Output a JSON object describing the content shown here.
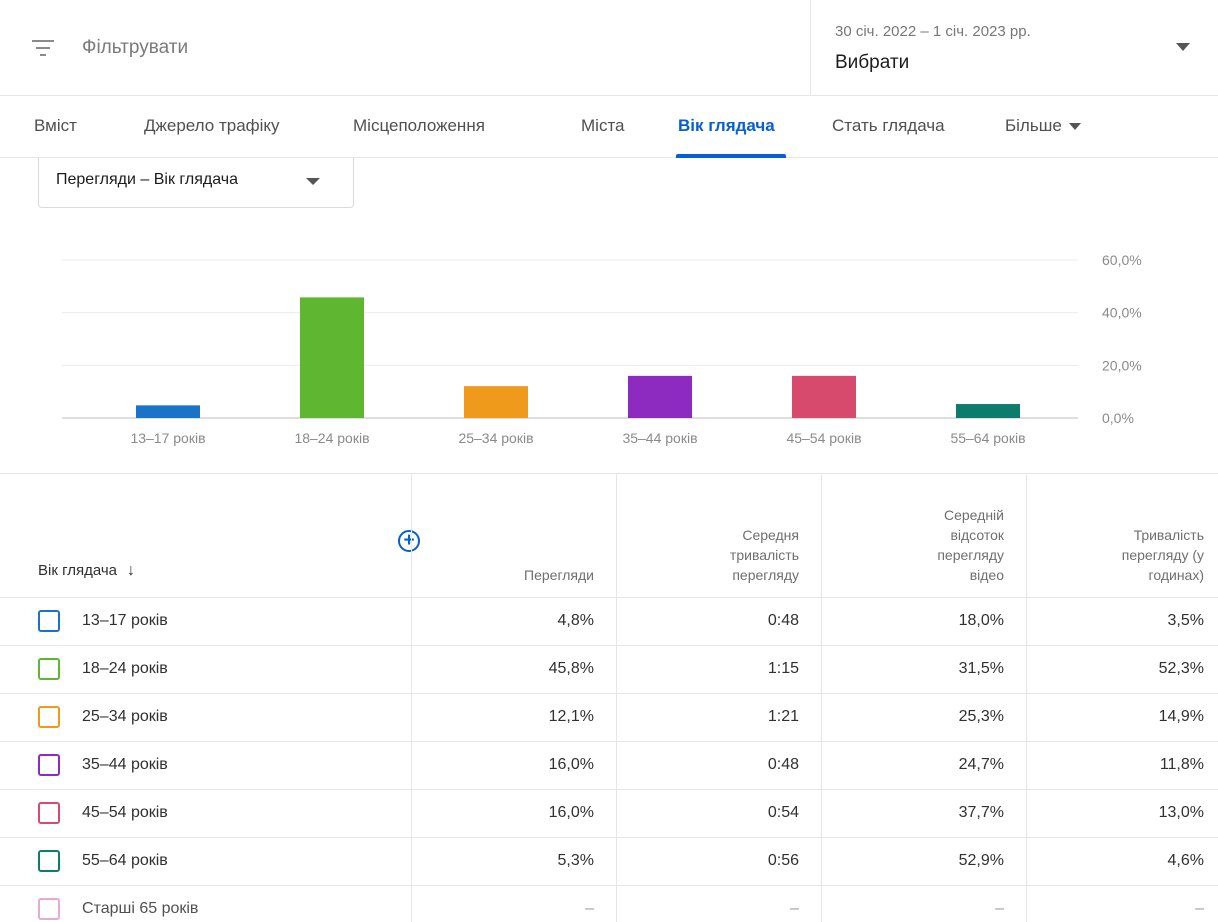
{
  "filter": {
    "label": "Фільтрувати"
  },
  "date": {
    "range": "30 січ. 2022 – 1 січ. 2023 рр.",
    "selector": "Вибрати"
  },
  "tabs": [
    {
      "label": "Вміст",
      "active": false
    },
    {
      "label": "Джерело трафіку",
      "active": false
    },
    {
      "label": "Місцеположення",
      "active": false
    },
    {
      "label": "Міста",
      "active": false
    },
    {
      "label": "Вік глядача",
      "active": true
    },
    {
      "label": "Стать глядача",
      "active": false
    },
    {
      "label": "Більше",
      "active": false
    }
  ],
  "metric_dropdown": {
    "label": "Перегляди – Вік глядача"
  },
  "chart_data": {
    "type": "bar",
    "categories": [
      "13–17 років",
      "18–24 років",
      "25–34 років",
      "35–44 років",
      "45–54 років",
      "55–64 років"
    ],
    "values": [
      4.8,
      45.8,
      12.1,
      16.0,
      16.0,
      5.3
    ],
    "colors": [
      "#1a73c8",
      "#5fb631",
      "#ef9a1a",
      "#8d2bc0",
      "#d84a6d",
      "#0c7c6c"
    ],
    "y_ticks": [
      "0,0%",
      "20,0%",
      "40,0%",
      "60,0%"
    ],
    "y_tick_values": [
      0,
      20,
      40,
      60
    ],
    "ylim": [
      0,
      60
    ],
    "grid": true,
    "y_axis_side": "right"
  },
  "table": {
    "columns": {
      "dimension": "Вік глядача",
      "views": "Перегляди",
      "avg_duration": [
        "Середня",
        "тривалість",
        "перегляду"
      ],
      "avg_percent": [
        "Середній",
        "відсоток",
        "перегляду",
        "відео"
      ],
      "watch_time": [
        "Тривалість",
        "перегляду (у",
        "годинах)"
      ]
    },
    "rows": [
      {
        "label": "13–17 років",
        "views": "4,8%",
        "avg_duration": "0:48",
        "avg_percent": "18,0%",
        "watch_time": "3,5%",
        "color": "#1a73c8"
      },
      {
        "label": "18–24 років",
        "views": "45,8%",
        "avg_duration": "1:15",
        "avg_percent": "31,5%",
        "watch_time": "52,3%",
        "color": "#5fb631"
      },
      {
        "label": "25–34 років",
        "views": "12,1%",
        "avg_duration": "1:21",
        "avg_percent": "25,3%",
        "watch_time": "14,9%",
        "color": "#ef9a1a"
      },
      {
        "label": "35–44 років",
        "views": "16,0%",
        "avg_duration": "0:48",
        "avg_percent": "24,7%",
        "watch_time": "11,8%",
        "color": "#8d2bc0"
      },
      {
        "label": "45–54 років",
        "views": "16,0%",
        "avg_duration": "0:54",
        "avg_percent": "37,7%",
        "watch_time": "13,0%",
        "color": "#d84a6d"
      },
      {
        "label": "55–64 років",
        "views": "5,3%",
        "avg_duration": "0:56",
        "avg_percent": "52,9%",
        "watch_time": "4,6%",
        "color": "#0c7c6c"
      },
      {
        "label": "Старші 65 років",
        "views": "–",
        "avg_duration": "–",
        "avg_percent": "–",
        "watch_time": "–",
        "color": "#e8a8d8"
      }
    ]
  },
  "icons": {
    "filter": "filter-lines-icon",
    "caret": "caret-down-icon",
    "sort": "arrow-down-icon",
    "add": "add-column-icon"
  },
  "colors": {
    "accent": "#065fd4"
  }
}
